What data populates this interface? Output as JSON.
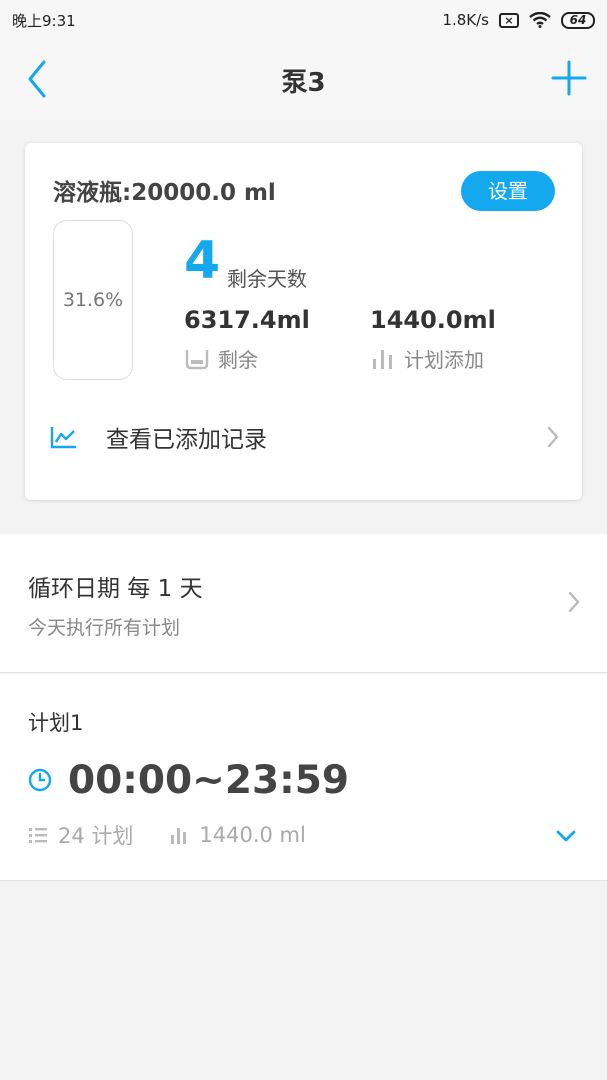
{
  "status_bar": {
    "time": "晚上9:31",
    "speed": "1.8K/s",
    "battery": "64"
  },
  "nav": {
    "title": "泵3"
  },
  "bottle_card": {
    "title": "溶液瓶:20000.0 ml",
    "settings_label": "设置",
    "fill_percent_text": "31.6%",
    "fill_fraction": 0.316,
    "days_value": "4",
    "days_label": "剩余天数",
    "remaining_value": "6317.4ml",
    "remaining_label": "剩余",
    "planned_value": "1440.0ml",
    "planned_label": "计划添加",
    "records_label": "查看已添加记录"
  },
  "cycle": {
    "title": "循环日期  每 1 天",
    "subtitle": "今天执行所有计划"
  },
  "plan": {
    "name": "计划1",
    "time_range": "00:00~23:59",
    "count_label": "24 计划",
    "amount_label": "1440.0 ml"
  },
  "colors": {
    "accent": "#14a8ee",
    "background": "#f3f3f3",
    "card": "#ffffff"
  },
  "icons": {
    "back": "chevron-left-icon",
    "add": "plus-icon",
    "remaining": "beaker-icon",
    "planned": "bar-chart-icon",
    "records": "line-chart-icon",
    "clock": "clock-icon",
    "list": "list-icon"
  }
}
